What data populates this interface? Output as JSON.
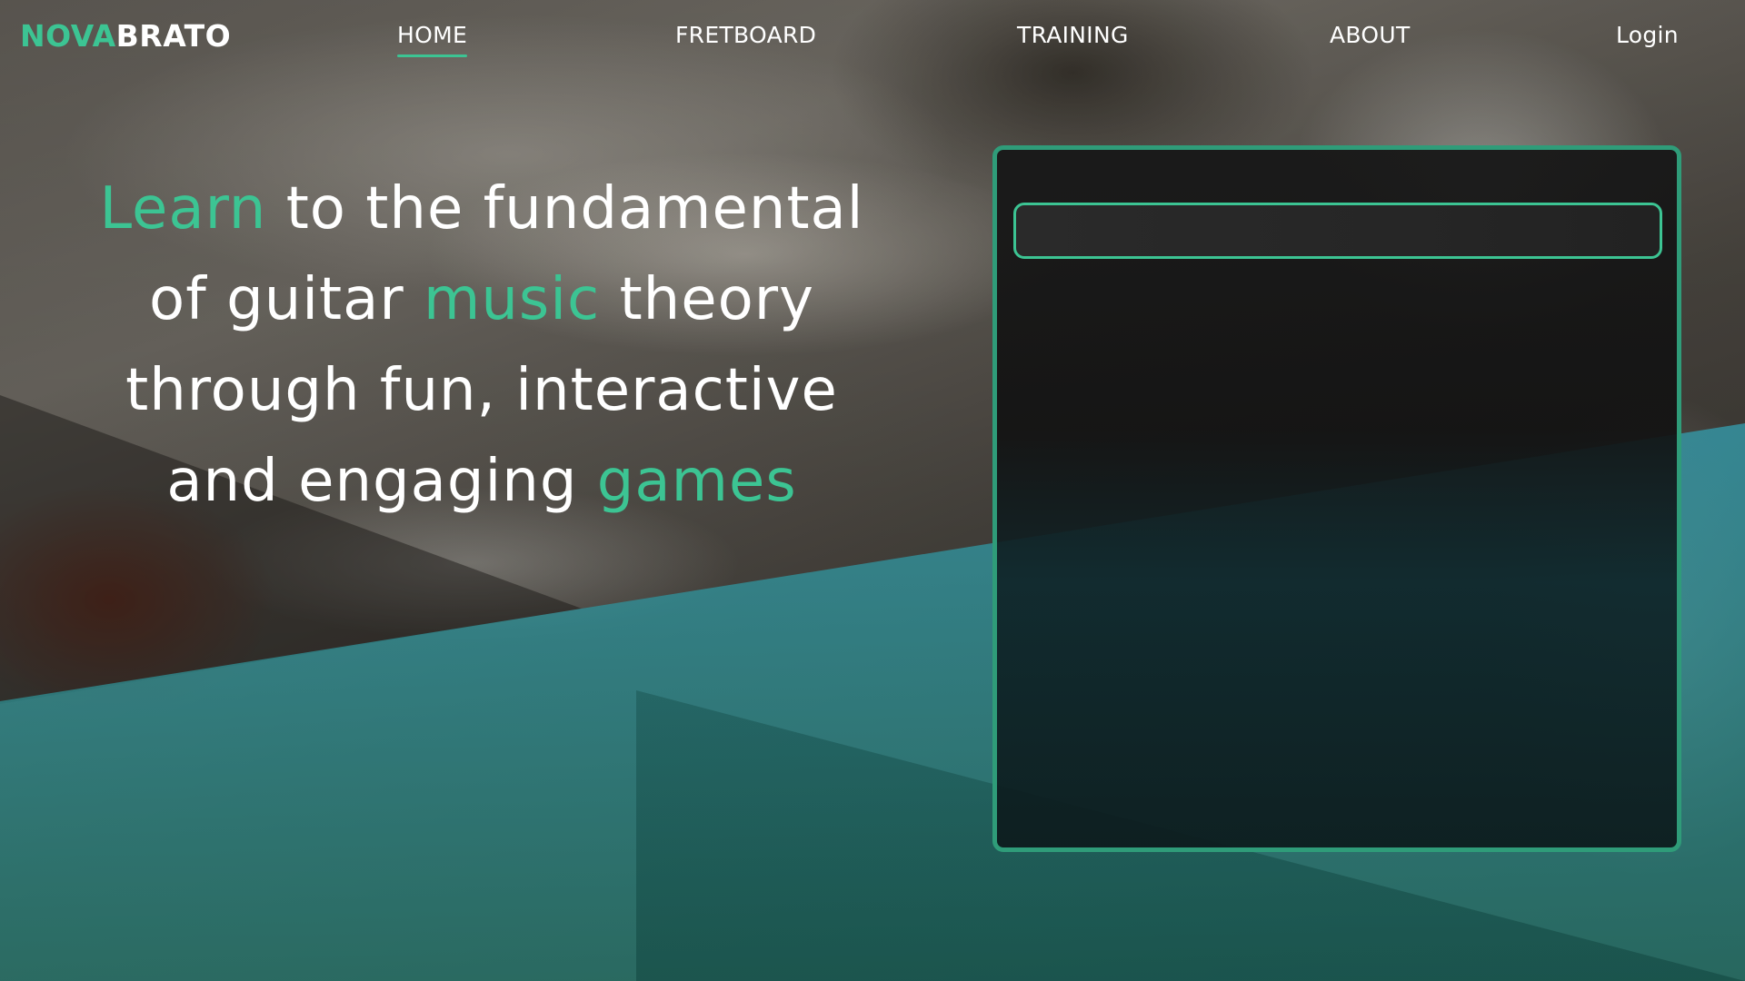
{
  "brand": {
    "logo_part1": "NOVA",
    "logo_part2": "BRATO",
    "accent_color": "#3cc493"
  },
  "nav": {
    "home": "HOME",
    "fretboard": "FRETBOARD",
    "training": "TRAINING",
    "about": "ABOUT",
    "login": "Login",
    "active": "HOME"
  },
  "hero": {
    "line1_highlight": "Learn",
    "line1_rest": " to the fundamental",
    "line2_start": "of guitar ",
    "line2_highlight": "music",
    "line2_end": " theory",
    "line3": "through fun, interactive",
    "line4_start": "and engaging ",
    "line4_highlight": "games"
  },
  "panel": {
    "input_value": "",
    "border_color": "#2f9c79"
  }
}
